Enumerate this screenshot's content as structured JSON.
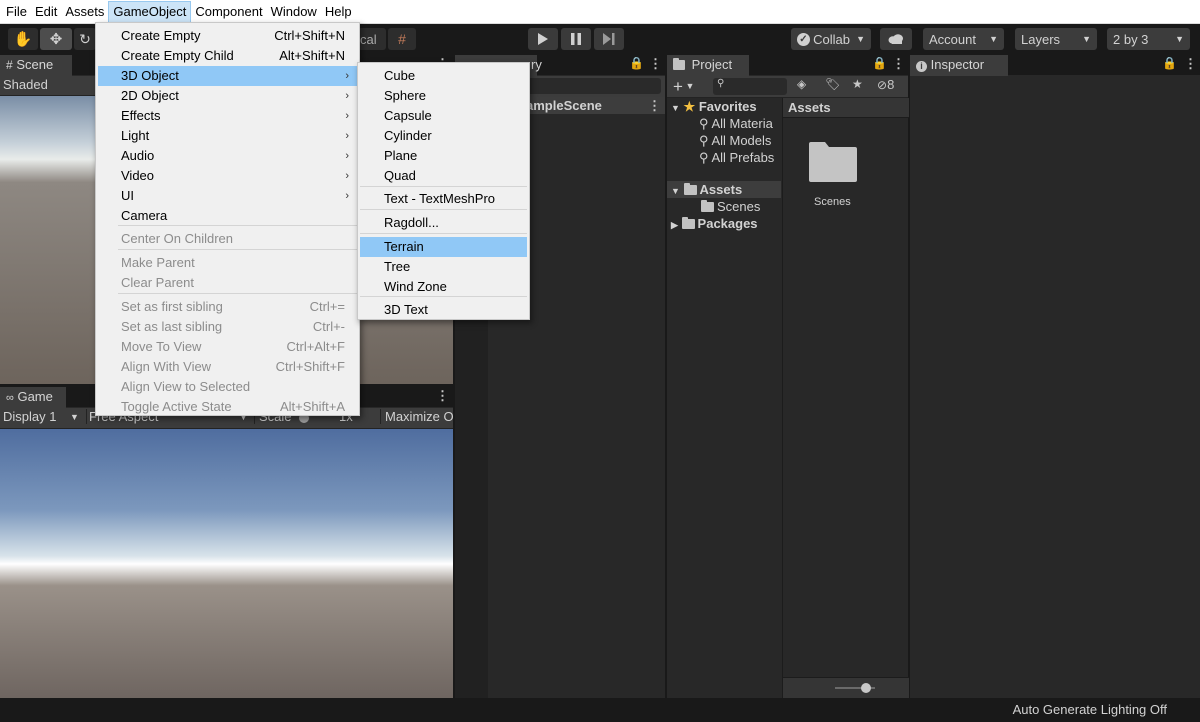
{
  "menubar": {
    "items": [
      "File",
      "Edit",
      "Assets",
      "GameObject",
      "Component",
      "Window",
      "Help"
    ]
  },
  "toolbar": {
    "center_label": "cal",
    "collab_label": "Collab",
    "account_label": "Account",
    "layers_label": "Layers",
    "layout_label": "2 by 3"
  },
  "scene_panel": {
    "tab": "Scene",
    "mode": "Shaded"
  },
  "game_panel": {
    "tab": "Game",
    "display": "Display 1",
    "aspect": "Free Aspect",
    "scale_label": "Scale",
    "scale_value": "1x",
    "maximize_label": "Maximize O"
  },
  "hierarchy_panel": {
    "tab_fragment": "ry",
    "scene_name": "ampleScene"
  },
  "project_panel": {
    "tab": "Project",
    "hidden_count": "8",
    "favorites_label": "Favorites",
    "favorites": [
      "All Materia",
      "All Models",
      "All Prefabs"
    ],
    "assets_label": "Assets",
    "assets_children": [
      "Scenes"
    ],
    "packages_label": "Packages",
    "breadcrumb": "Assets",
    "folder_item": "Scenes"
  },
  "inspector_panel": {
    "tab": "Inspector"
  },
  "gameobject_menu": {
    "items": [
      {
        "label": "Create Empty",
        "shortcut": "Ctrl+Shift+N",
        "enabled": true
      },
      {
        "label": "Create Empty Child",
        "shortcut": "Alt+Shift+N",
        "enabled": true
      },
      {
        "label": "3D Object",
        "submenu": true,
        "enabled": true,
        "highlighted": true
      },
      {
        "label": "2D Object",
        "submenu": true,
        "enabled": true
      },
      {
        "label": "Effects",
        "submenu": true,
        "enabled": true
      },
      {
        "label": "Light",
        "submenu": true,
        "enabled": true
      },
      {
        "label": "Audio",
        "submenu": true,
        "enabled": true
      },
      {
        "label": "Video",
        "submenu": true,
        "enabled": true
      },
      {
        "label": "UI",
        "submenu": true,
        "enabled": true
      },
      {
        "label": "Camera",
        "enabled": true
      },
      {
        "label": "Center On Children",
        "enabled": false
      },
      {
        "label": "Make Parent",
        "enabled": false
      },
      {
        "label": "Clear Parent",
        "enabled": false
      },
      {
        "label": "Set as first sibling",
        "shortcut": "Ctrl+=",
        "enabled": false
      },
      {
        "label": "Set as last sibling",
        "shortcut": "Ctrl+-",
        "enabled": false
      },
      {
        "label": "Move To View",
        "shortcut": "Ctrl+Alt+F",
        "enabled": false
      },
      {
        "label": "Align With View",
        "shortcut": "Ctrl+Shift+F",
        "enabled": false
      },
      {
        "label": "Align View to Selected",
        "enabled": false
      },
      {
        "label": "Toggle Active State",
        "shortcut": "Alt+Shift+A",
        "enabled": false
      }
    ]
  },
  "submenu_3d": {
    "items": [
      "Cube",
      "Sphere",
      "Capsule",
      "Cylinder",
      "Plane",
      "Quad",
      "Text - TextMeshPro",
      "Ragdoll...",
      "Terrain",
      "Tree",
      "Wind Zone",
      "3D Text"
    ],
    "highlighted": "Terrain"
  },
  "statusbar": {
    "text": "Auto Generate Lighting Off"
  },
  "colors": {
    "menu_highlight": "#90c8f6",
    "editor_dark": "#282828",
    "tab_bg": "#3c3c3c"
  }
}
